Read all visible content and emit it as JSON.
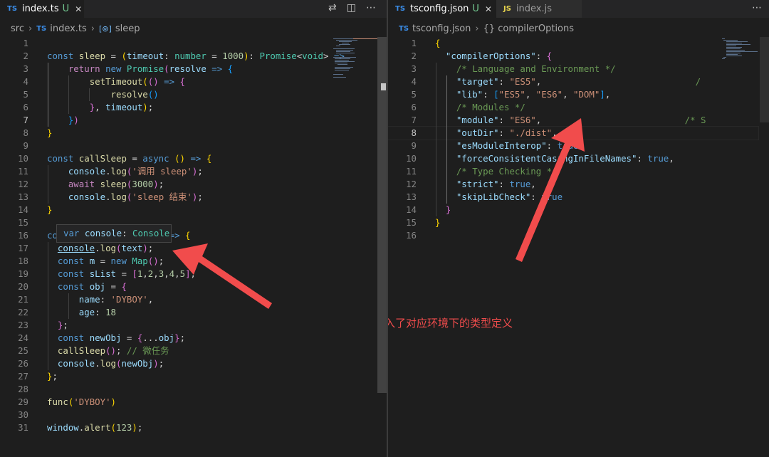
{
  "left_editor": {
    "tabs": [
      {
        "lang": "TS",
        "label": "index.ts",
        "flag": "U",
        "active": true
      }
    ],
    "tab_actions": [
      "compare-changes-icon",
      "split-editor-icon",
      "more-actions-icon"
    ],
    "breadcrumb": [
      "src",
      "index.ts",
      "sleep"
    ],
    "lines": [
      [],
      [
        [
          "kw",
          "const "
        ],
        [
          "fn",
          "sleep"
        ],
        [
          "pn",
          " = "
        ],
        [
          "br1",
          "("
        ],
        [
          "var",
          "timeout"
        ],
        [
          "pn",
          ": "
        ],
        [
          "ty",
          "number"
        ],
        [
          "pn",
          " = "
        ],
        [
          "num",
          "1000"
        ],
        [
          "br1",
          ")"
        ],
        [
          "pn",
          ": "
        ],
        [
          "ty",
          "Promise"
        ],
        [
          "pn",
          "<"
        ],
        [
          "ty",
          "void"
        ],
        [
          "pn",
          "> "
        ],
        [
          "kw",
          "=>"
        ]
      ],
      [
        [
          "pn",
          "    "
        ],
        [
          "ctl",
          "return "
        ],
        [
          "kw",
          "new "
        ],
        [
          "ty",
          "Promise"
        ],
        [
          "br2",
          "("
        ],
        [
          "var",
          "resolve"
        ],
        [
          "pn",
          " "
        ],
        [
          "kw",
          "=>"
        ],
        [
          "pn",
          " "
        ],
        [
          "br3",
          "{"
        ]
      ],
      [
        [
          "pn",
          "        "
        ],
        [
          "fn",
          "setTimeout"
        ],
        [
          "br1",
          "("
        ],
        [
          "br2",
          "()"
        ],
        [
          "pn",
          " "
        ],
        [
          "kw",
          "=>"
        ],
        [
          "pn",
          " "
        ],
        [
          "br2",
          "{"
        ]
      ],
      [
        [
          "pn",
          "            "
        ],
        [
          "fn",
          "resolve"
        ],
        [
          "br3",
          "()"
        ]
      ],
      [
        [
          "pn",
          "        "
        ],
        [
          "br2",
          "}"
        ],
        [
          "pn",
          ", "
        ],
        [
          "var",
          "timeout"
        ],
        [
          "br1",
          ")"
        ],
        [
          "pn",
          ";"
        ]
      ],
      [
        [
          "pn",
          "    "
        ],
        [
          "br3",
          "}"
        ],
        [
          "br2",
          ")"
        ]
      ],
      [
        [
          "br1",
          "}"
        ]
      ],
      [],
      [
        [
          "kw",
          "const "
        ],
        [
          "fn",
          "callSleep"
        ],
        [
          "pn",
          " = "
        ],
        [
          "kw",
          "async "
        ],
        [
          "br1",
          "()"
        ],
        [
          "pn",
          " "
        ],
        [
          "kw",
          "=>"
        ],
        [
          "pn",
          " "
        ],
        [
          "br1",
          "{"
        ]
      ],
      [
        [
          "pn",
          "    "
        ],
        [
          "var",
          "console"
        ],
        [
          "pn",
          "."
        ],
        [
          "fn",
          "log"
        ],
        [
          "br2",
          "("
        ],
        [
          "str",
          "'调用 sleep'"
        ],
        [
          "br2",
          ")"
        ],
        [
          "pn",
          ";"
        ]
      ],
      [
        [
          "pn",
          "    "
        ],
        [
          "ctl",
          "await "
        ],
        [
          "fn",
          "sleep"
        ],
        [
          "br2",
          "("
        ],
        [
          "num",
          "3000"
        ],
        [
          "br2",
          ")"
        ],
        [
          "pn",
          ";"
        ]
      ],
      [
        [
          "pn",
          "    "
        ],
        [
          "var",
          "console"
        ],
        [
          "pn",
          "."
        ],
        [
          "fn",
          "log"
        ],
        [
          "br2",
          "("
        ],
        [
          "str",
          "'sleep 结束'"
        ],
        [
          "br2",
          ")"
        ],
        [
          "pn",
          ";"
        ]
      ],
      [
        [
          "br1",
          "}"
        ]
      ],
      [],
      [
        [
          "kw",
          "co"
        ],
        [
          "pn",
          "                 "
        ],
        [
          "var",
          "ng"
        ],
        [
          "br1",
          ")"
        ],
        [
          "pn",
          " "
        ],
        [
          "kw",
          "=>"
        ],
        [
          "pn",
          " "
        ],
        [
          "br1",
          "{"
        ]
      ],
      [
        [
          "pn",
          "  "
        ],
        [
          "var",
          "console"
        ],
        [
          "pn",
          "."
        ],
        [
          "fn",
          "log"
        ],
        [
          "br2",
          "("
        ],
        [
          "var",
          "text"
        ],
        [
          "br2",
          ")"
        ],
        [
          "pn",
          ";"
        ]
      ],
      [
        [
          "pn",
          "  "
        ],
        [
          "kw",
          "const "
        ],
        [
          "var",
          "m"
        ],
        [
          "pn",
          " = "
        ],
        [
          "kw",
          "new "
        ],
        [
          "ty",
          "Map"
        ],
        [
          "br2",
          "()"
        ],
        [
          "pn",
          ";"
        ]
      ],
      [
        [
          "pn",
          "  "
        ],
        [
          "kw",
          "const "
        ],
        [
          "var",
          "sList"
        ],
        [
          "pn",
          " = "
        ],
        [
          "br2",
          "["
        ],
        [
          "num",
          "1"
        ],
        [
          "pn",
          ","
        ],
        [
          "num",
          "2"
        ],
        [
          "pn",
          ","
        ],
        [
          "num",
          "3"
        ],
        [
          "pn",
          ","
        ],
        [
          "num",
          "4"
        ],
        [
          "pn",
          ","
        ],
        [
          "num",
          "5"
        ],
        [
          "br2",
          "]"
        ],
        [
          "pn",
          ";"
        ]
      ],
      [
        [
          "pn",
          "  "
        ],
        [
          "kw",
          "const "
        ],
        [
          "var",
          "obj"
        ],
        [
          "pn",
          " = "
        ],
        [
          "br2",
          "{"
        ]
      ],
      [
        [
          "pn",
          "      "
        ],
        [
          "var",
          "name"
        ],
        [
          "pn",
          ": "
        ],
        [
          "str",
          "'DYBOY'"
        ],
        [
          "pn",
          ","
        ]
      ],
      [
        [
          "pn",
          "      "
        ],
        [
          "var",
          "age"
        ],
        [
          "pn",
          ": "
        ],
        [
          "num",
          "18"
        ]
      ],
      [
        [
          "pn",
          "  "
        ],
        [
          "br2",
          "}"
        ],
        [
          "pn",
          ";"
        ]
      ],
      [
        [
          "pn",
          "  "
        ],
        [
          "kw",
          "const "
        ],
        [
          "var",
          "newObj"
        ],
        [
          "pn",
          " = "
        ],
        [
          "br2",
          "{"
        ],
        [
          "pn",
          "..."
        ],
        [
          "var",
          "obj"
        ],
        [
          "br2",
          "}"
        ],
        [
          "pn",
          ";"
        ]
      ],
      [
        [
          "pn",
          "  "
        ],
        [
          "fn",
          "callSleep"
        ],
        [
          "br2",
          "()"
        ],
        [
          "pn",
          "; "
        ],
        [
          "cmt",
          "// 微任务"
        ]
      ],
      [
        [
          "pn",
          "  "
        ],
        [
          "var",
          "console"
        ],
        [
          "pn",
          "."
        ],
        [
          "fn",
          "log"
        ],
        [
          "br2",
          "("
        ],
        [
          "var",
          "newObj"
        ],
        [
          "br2",
          ")"
        ],
        [
          "pn",
          ";"
        ]
      ],
      [
        [
          "br1",
          "}"
        ],
        [
          "pn",
          ";"
        ]
      ],
      [],
      [
        [
          "fn",
          "func"
        ],
        [
          "br1",
          "("
        ],
        [
          "str",
          "'DYBOY'"
        ],
        [
          "br1",
          ")"
        ]
      ],
      [],
      [
        [
          "var",
          "window"
        ],
        [
          "pn",
          "."
        ],
        [
          "fn",
          "alert"
        ],
        [
          "br1",
          "("
        ],
        [
          "num",
          "123"
        ],
        [
          "br1",
          ")"
        ],
        [
          "pn",
          ";"
        ]
      ]
    ],
    "current_line": 7,
    "hover_tooltip": [
      [
        "kw",
        "var "
      ],
      [
        "var",
        "console"
      ],
      [
        "pn",
        ": "
      ],
      [
        "ty",
        "Console"
      ]
    ]
  },
  "right_editor": {
    "tabs": [
      {
        "lang": "TS",
        "label": "tsconfig.json",
        "flag": "U",
        "active": true
      },
      {
        "lang": "JS",
        "label": "index.js",
        "flag": "",
        "active": false
      }
    ],
    "tab_actions": [
      "more-actions-icon"
    ],
    "breadcrumb": [
      "tsconfig.json",
      "{} compilerOptions"
    ],
    "lines": [
      [
        [
          "br1",
          "{"
        ]
      ],
      [
        [
          "pn",
          "  "
        ],
        [
          "var",
          "\"compilerOptions\""
        ],
        [
          "pn",
          ": "
        ],
        [
          "br2",
          "{"
        ]
      ],
      [
        [
          "pn",
          "    "
        ],
        [
          "cmt",
          "/* Language and Environment */"
        ]
      ],
      [
        [
          "pn",
          "    "
        ],
        [
          "var",
          "\"target\""
        ],
        [
          "pn",
          ": "
        ],
        [
          "str",
          "\"ES5\""
        ],
        [
          "pn",
          ","
        ],
        [
          "pn",
          "                             "
        ],
        [
          "cmt",
          "/"
        ]
      ],
      [
        [
          "pn",
          "    "
        ],
        [
          "var",
          "\"lib\""
        ],
        [
          "pn",
          ": "
        ],
        [
          "br3",
          "["
        ],
        [
          "str",
          "\"ES5\""
        ],
        [
          "pn",
          ", "
        ],
        [
          "str",
          "\"ES6\""
        ],
        [
          "pn",
          ", "
        ],
        [
          "str",
          "\"DOM\""
        ],
        [
          "br3",
          "]"
        ],
        [
          "pn",
          ","
        ]
      ],
      [
        [
          "pn",
          "    "
        ],
        [
          "cmt",
          "/* Modules */"
        ]
      ],
      [
        [
          "pn",
          "    "
        ],
        [
          "var",
          "\"module\""
        ],
        [
          "pn",
          ": "
        ],
        [
          "str",
          "\"ES6\""
        ],
        [
          "pn",
          ","
        ],
        [
          "pn",
          "                           "
        ],
        [
          "cmt",
          "/* S"
        ]
      ],
      [
        [
          "pn",
          "    "
        ],
        [
          "var",
          "\"outDir\""
        ],
        [
          "pn",
          ": "
        ],
        [
          "str",
          "\"./dist\""
        ],
        [
          "pn",
          ","
        ]
      ],
      [
        [
          "pn",
          "    "
        ],
        [
          "var",
          "\"esModuleInterop\""
        ],
        [
          "pn",
          ": "
        ],
        [
          "kw",
          "true"
        ],
        [
          "pn",
          ","
        ]
      ],
      [
        [
          "pn",
          "    "
        ],
        [
          "var",
          "\"forceConsistentCasingInFileNames\""
        ],
        [
          "pn",
          ": "
        ],
        [
          "kw",
          "true"
        ],
        [
          "pn",
          ","
        ]
      ],
      [
        [
          "pn",
          "    "
        ],
        [
          "cmt",
          "/* Type Checking */"
        ]
      ],
      [
        [
          "pn",
          "    "
        ],
        [
          "var",
          "\"strict\""
        ],
        [
          "pn",
          ": "
        ],
        [
          "kw",
          "true"
        ],
        [
          "pn",
          ","
        ]
      ],
      [
        [
          "pn",
          "    "
        ],
        [
          "var",
          "\"skipLibCheck\""
        ],
        [
          "pn",
          ": "
        ],
        [
          "kw",
          "true"
        ]
      ],
      [
        [
          "pn",
          "  "
        ],
        [
          "br2",
          "}"
        ]
      ],
      [
        [
          "br1",
          "}"
        ]
      ],
      []
    ],
    "current_line": 8
  },
  "annotation": {
    "text": "引入了对应环境下的类型定义",
    "color": "#f14c4c"
  },
  "colors": {
    "editor_bg": "#1e1e1e",
    "tabbar_bg": "#252526",
    "keyword": "#569cd6",
    "string": "#ce9178",
    "function": "#dcdcaa",
    "type": "#4ec9b0",
    "arrow_red": "#f14c4c"
  }
}
